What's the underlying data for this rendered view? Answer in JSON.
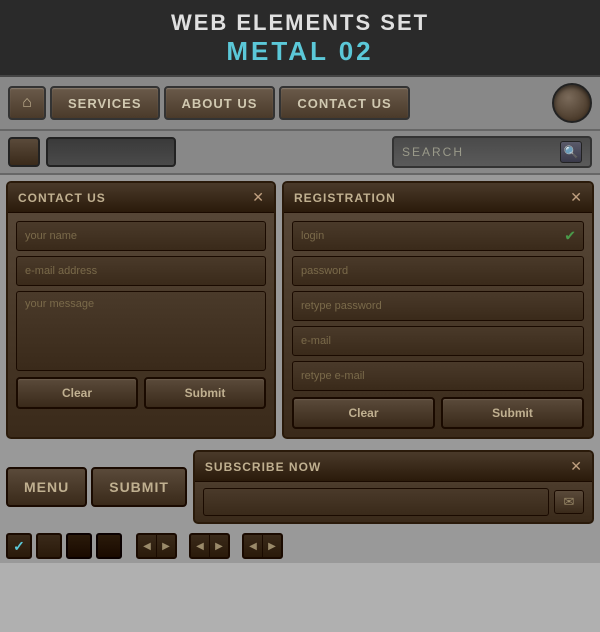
{
  "header": {
    "title": "WEB ELEMENTS SET",
    "subtitle": "METAL 02"
  },
  "navbar": {
    "home_icon": "🏠",
    "services": "SERVICES",
    "about_us": "ABOUT US",
    "contact_us": "CONTACT US"
  },
  "search": {
    "placeholder": "SEARCH",
    "icon": "🔍"
  },
  "contact_panel": {
    "title": "CONTACT US",
    "close": "✕",
    "name_placeholder": "your name",
    "email_placeholder": "e-mail address",
    "message_placeholder": "your message",
    "clear_btn": "Clear",
    "submit_btn": "Submit"
  },
  "registration_panel": {
    "title": "REGISTRATION",
    "close": "✕",
    "login_placeholder": "login",
    "password_placeholder": "password",
    "retype_password_placeholder": "retype password",
    "email_placeholder": "e-mail",
    "retype_email_placeholder": "retype e-mail",
    "clear_btn": "Clear",
    "submit_btn": "Submit",
    "check_icon": "✔"
  },
  "bottom": {
    "menu_btn": "MENU",
    "submit_btn": "SUBMIT",
    "subscribe_panel": {
      "title": "SUBSCRIBE NOW",
      "close": "✕",
      "email_icon": "✉"
    }
  },
  "controls": {
    "arrow_left": "◀",
    "arrow_right": "▶",
    "arrow_left2": "◀",
    "arrow_right2": "▶",
    "arrow_left3": "◀",
    "arrow_right3": "▶"
  }
}
